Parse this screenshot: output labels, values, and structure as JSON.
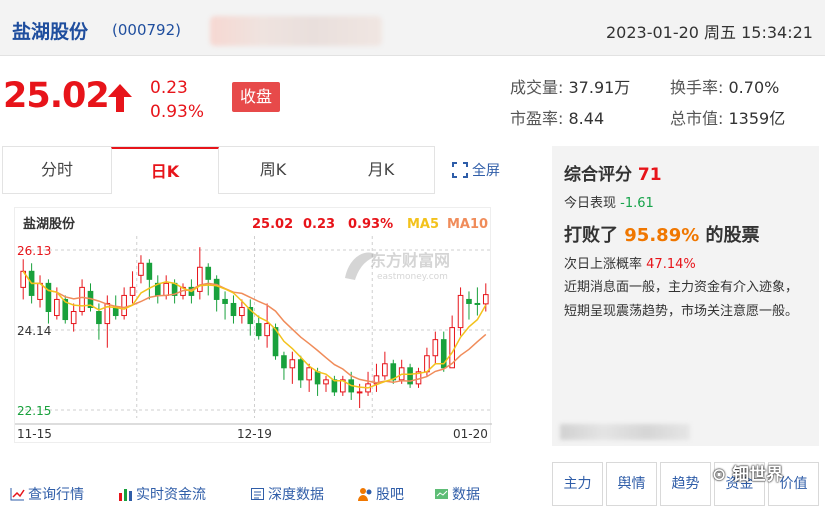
{
  "header": {
    "stock_name": "盐湖股份",
    "stock_code": "(000792)",
    "datetime": "2023-01-20 周五 15:34:21"
  },
  "quote": {
    "price": "25.02",
    "change": "0.23",
    "change_pct": "0.93%",
    "status": "收盘",
    "volume_label": "成交量:",
    "volume": "37.91万",
    "turnover_label": "换手率:",
    "turnover": "0.70%",
    "pe_label": "市盈率:",
    "pe": "8.44",
    "mktcap_label": "总市值:",
    "mktcap": "1359亿"
  },
  "tabs": [
    "分时",
    "日K",
    "周K",
    "月K"
  ],
  "fullscreen_label": "全屏",
  "chart": {
    "stock_name": "盐湖股份",
    "price": "25.02",
    "change": "0.23",
    "change_pct": "0.93%",
    "ma5_label": "MA5",
    "ma10_label": "MA10",
    "watermark_cn": "东方财富网",
    "watermark_en": "eastmoney.com",
    "ytick_top": "26.13",
    "ytick_mid": "24.14",
    "ytick_bottom": "22.15",
    "xtick_1": "11-15",
    "xtick_2": "12-19",
    "xtick_3": "01-20",
    "up_color": "#e7141a",
    "down_color": "#19a13c",
    "ma5_color": "#f3c21c",
    "ma10_color": "#f08c5a"
  },
  "chart_data": {
    "type": "candlestick",
    "y_ticks": [
      26.13,
      24.14,
      22.15
    ],
    "x_ticks": [
      "11-15",
      "12-19",
      "01-20"
    ],
    "series": [
      {
        "name": "MA5"
      },
      {
        "name": "MA10"
      }
    ],
    "candles": [
      {
        "o": 25.2,
        "c": 25.6,
        "h": 25.9,
        "l": 24.9
      },
      {
        "o": 25.6,
        "c": 25.0,
        "h": 25.8,
        "l": 24.8
      },
      {
        "o": 24.9,
        "c": 25.3,
        "h": 25.5,
        "l": 24.7
      },
      {
        "o": 25.3,
        "c": 24.6,
        "h": 25.4,
        "l": 24.3
      },
      {
        "o": 24.5,
        "c": 24.9,
        "h": 25.2,
        "l": 24.4
      },
      {
        "o": 24.9,
        "c": 24.4,
        "h": 25.0,
        "l": 24.3
      },
      {
        "o": 24.3,
        "c": 24.6,
        "h": 24.8,
        "l": 24.1
      },
      {
        "o": 24.6,
        "c": 25.2,
        "h": 25.4,
        "l": 24.5
      },
      {
        "o": 25.1,
        "c": 24.7,
        "h": 25.3,
        "l": 24.6
      },
      {
        "o": 24.6,
        "c": 24.3,
        "h": 24.8,
        "l": 23.9
      },
      {
        "o": 24.3,
        "c": 24.8,
        "h": 25.0,
        "l": 23.7
      },
      {
        "o": 24.7,
        "c": 24.5,
        "h": 25.0,
        "l": 24.4
      },
      {
        "o": 24.5,
        "c": 25.0,
        "h": 25.2,
        "l": 24.4
      },
      {
        "o": 25.0,
        "c": 25.2,
        "h": 25.6,
        "l": 24.8
      },
      {
        "o": 25.5,
        "c": 25.8,
        "h": 26.0,
        "l": 25.3
      },
      {
        "o": 25.8,
        "c": 25.4,
        "h": 25.9,
        "l": 24.9
      },
      {
        "o": 25.3,
        "c": 25.0,
        "h": 25.5,
        "l": 24.8
      },
      {
        "o": 25.0,
        "c": 25.3,
        "h": 25.5,
        "l": 24.9
      },
      {
        "o": 25.3,
        "c": 25.0,
        "h": 25.4,
        "l": 24.8
      },
      {
        "o": 25.0,
        "c": 25.2,
        "h": 25.3,
        "l": 24.9
      },
      {
        "o": 25.2,
        "c": 25.0,
        "h": 25.4,
        "l": 24.8
      },
      {
        "o": 25.1,
        "c": 25.7,
        "h": 26.2,
        "l": 24.9
      },
      {
        "o": 25.7,
        "c": 25.4,
        "h": 25.8,
        "l": 25.0
      },
      {
        "o": 25.4,
        "c": 24.9,
        "h": 25.5,
        "l": 24.6
      },
      {
        "o": 24.9,
        "c": 24.8,
        "h": 25.1,
        "l": 24.4
      },
      {
        "o": 24.8,
        "c": 24.5,
        "h": 25.0,
        "l": 24.3
      },
      {
        "o": 24.5,
        "c": 24.7,
        "h": 24.9,
        "l": 24.3
      },
      {
        "o": 24.7,
        "c": 24.3,
        "h": 24.9,
        "l": 24.0
      },
      {
        "o": 24.3,
        "c": 24.0,
        "h": 24.5,
        "l": 23.9
      },
      {
        "o": 24.0,
        "c": 24.3,
        "h": 24.8,
        "l": 23.7
      },
      {
        "o": 24.2,
        "c": 23.5,
        "h": 24.3,
        "l": 23.4
      },
      {
        "o": 23.5,
        "c": 23.2,
        "h": 23.6,
        "l": 22.9
      },
      {
        "o": 23.2,
        "c": 23.4,
        "h": 23.6,
        "l": 22.8
      },
      {
        "o": 23.4,
        "c": 22.9,
        "h": 23.5,
        "l": 22.7
      },
      {
        "o": 22.9,
        "c": 23.2,
        "h": 23.3,
        "l": 22.6
      },
      {
        "o": 23.1,
        "c": 22.8,
        "h": 23.2,
        "l": 22.5
      },
      {
        "o": 22.8,
        "c": 22.9,
        "h": 23.0,
        "l": 22.6
      },
      {
        "o": 22.9,
        "c": 22.6,
        "h": 23.0,
        "l": 22.5
      },
      {
        "o": 22.6,
        "c": 22.9,
        "h": 23.0,
        "l": 22.5
      },
      {
        "o": 22.9,
        "c": 22.6,
        "h": 23.1,
        "l": 22.4
      },
      {
        "o": 22.6,
        "c": 22.6,
        "h": 22.8,
        "l": 22.2
      },
      {
        "o": 22.6,
        "c": 22.8,
        "h": 23.1,
        "l": 22.5
      },
      {
        "o": 22.8,
        "c": 23.0,
        "h": 23.3,
        "l": 22.6
      },
      {
        "o": 23.0,
        "c": 23.3,
        "h": 23.6,
        "l": 22.9
      },
      {
        "o": 23.3,
        "c": 22.9,
        "h": 23.4,
        "l": 22.8
      },
      {
        "o": 22.9,
        "c": 23.2,
        "h": 23.4,
        "l": 22.8
      },
      {
        "o": 23.2,
        "c": 22.8,
        "h": 23.3,
        "l": 22.7
      },
      {
        "o": 22.8,
        "c": 23.1,
        "h": 23.2,
        "l": 22.7
      },
      {
        "o": 23.1,
        "c": 23.5,
        "h": 23.7,
        "l": 23.0
      },
      {
        "o": 23.5,
        "c": 23.9,
        "h": 24.1,
        "l": 23.3
      },
      {
        "o": 23.9,
        "c": 23.2,
        "h": 24.1,
        "l": 23.1
      },
      {
        "o": 23.2,
        "c": 24.2,
        "h": 24.5,
        "l": 23.2
      },
      {
        "o": 24.2,
        "c": 25.0,
        "h": 25.2,
        "l": 24.0
      },
      {
        "o": 24.9,
        "c": 24.8,
        "h": 25.1,
        "l": 24.4
      },
      {
        "o": 24.8,
        "c": 24.79,
        "h": 25.2,
        "l": 24.5
      },
      {
        "o": 24.79,
        "c": 25.02,
        "h": 25.3,
        "l": 24.6
      }
    ]
  },
  "score": {
    "label": "综合评分",
    "value": "71",
    "today_label": "今日表现",
    "today_value": "-1.61",
    "beat_prefix": "打败了",
    "beat_pct": "95.89%",
    "beat_suffix": "的股票",
    "prob_label": "次日上涨概率",
    "prob_value": "47.14%",
    "description": "近期消息面一般，主力资金有介入迹象，短期呈现震荡趋势，市场关注意愿一般。"
  },
  "bottom_links": [
    "查询行情",
    "实时资金流",
    "深度数据",
    "股吧",
    "数据"
  ],
  "side_buttons": [
    "主力",
    "舆情",
    "趋势",
    "资金",
    "价值"
  ],
  "watermark": "钿世界"
}
